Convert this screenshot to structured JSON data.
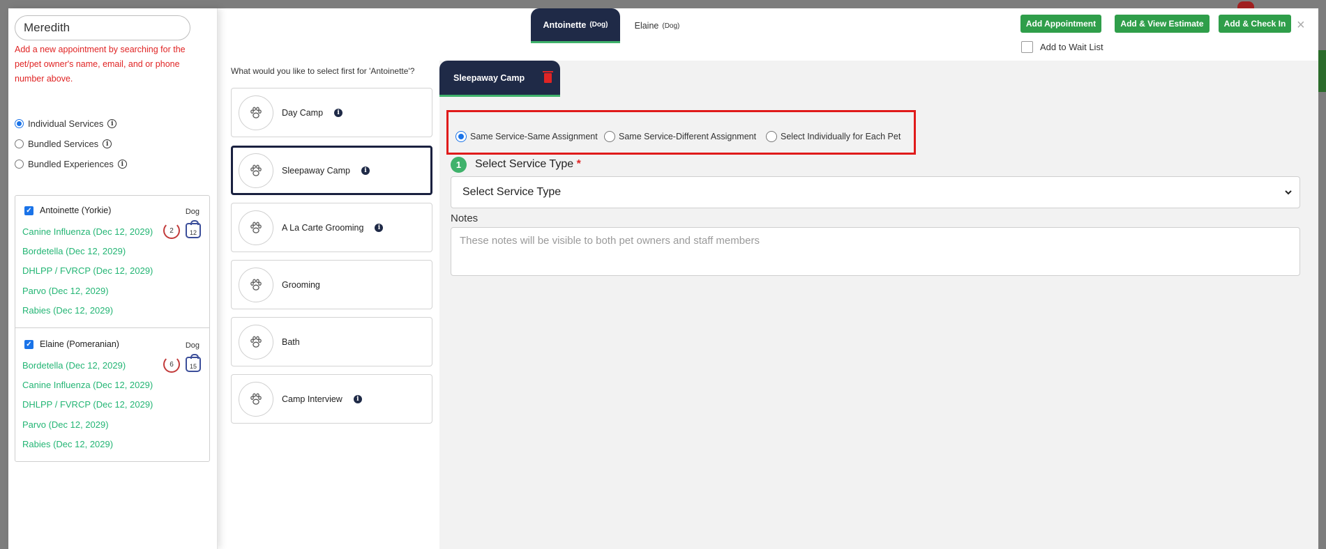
{
  "search": {
    "value": "Meredith",
    "hint": "Add a new appointment by searching for the pet/pet owner's name, email, and or phone number above."
  },
  "service_modes": [
    {
      "label": "Individual Services",
      "selected": true
    },
    {
      "label": "Bundled Services",
      "selected": false
    },
    {
      "label": "Bundled Experiences",
      "selected": false
    }
  ],
  "pets": [
    {
      "name": "Antoinette (Yorkie)",
      "species": "Dog",
      "checked": true,
      "refresh_count": "2",
      "weight": "12",
      "vaccines": [
        "Canine Influenza (Dec 12, 2029)",
        "Bordetella (Dec 12, 2029)",
        "DHLPP / FVRCP (Dec 12, 2029)",
        "Parvo (Dec 12, 2029)",
        "Rabies (Dec 12, 2029)"
      ]
    },
    {
      "name": "Elaine (Pomeranian)",
      "species": "Dog",
      "checked": true,
      "refresh_count": "6",
      "weight": "15",
      "vaccines": [
        "Bordetella (Dec 12, 2029)",
        "Canine Influenza (Dec 12, 2029)",
        "DHLPP / FVRCP (Dec 12, 2029)",
        "Parvo (Dec 12, 2029)",
        "Rabies (Dec 12, 2029)"
      ]
    }
  ],
  "pet_tabs": [
    {
      "name": "Antoinette",
      "type": "(Dog)",
      "active": true
    },
    {
      "name": "Elaine",
      "type": "(Dog)",
      "active": false
    }
  ],
  "actions": {
    "add_appointment": "Add Appointment",
    "add_view_estimate": "Add & View Estimate",
    "add_check_in": "Add & Check In",
    "close": "×",
    "wait_list": "Add to Wait List"
  },
  "select_question": "What would you like to select first for 'Antoinette'?",
  "services": [
    {
      "label": "Day Camp",
      "info": true,
      "selected": false
    },
    {
      "label": "Sleepaway Camp",
      "info": true,
      "selected": true
    },
    {
      "label": "A La Carte Grooming",
      "info": true,
      "selected": false
    },
    {
      "label": "Grooming",
      "info": false,
      "selected": false
    },
    {
      "label": "Bath",
      "info": false,
      "selected": false
    },
    {
      "label": "Camp Interview",
      "info": true,
      "selected": false
    }
  ],
  "workspace": {
    "tab_label": "Sleepaway Camp",
    "assignment_options": [
      {
        "label": "Same Service-Same Assignment",
        "selected": true
      },
      {
        "label": "Same Service-Different Assignment",
        "selected": false
      },
      {
        "label": "Select Individually for Each Pet",
        "selected": false
      }
    ],
    "step_number": "1",
    "step_label": "Select Service Type",
    "required_mark": "*",
    "service_type_placeholder": "Select Service Type",
    "notes_label": "Notes",
    "notes_placeholder": "These notes will be visible to both pet owners and staff members"
  },
  "colors": {
    "accent_green": "#2f9e4a",
    "navy": "#1f2a47",
    "error_red": "#e02424",
    "vaccine_green": "#23b574"
  }
}
